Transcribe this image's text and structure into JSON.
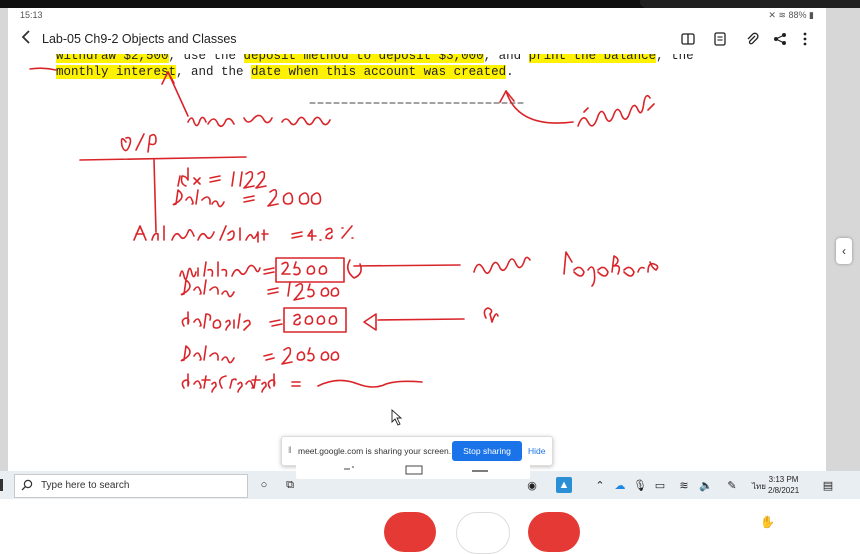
{
  "status_bar": {
    "time": "15:13",
    "battery": "88%"
  },
  "header": {
    "back_icon": "chevron-left-icon",
    "title": "Lab-05 Ch9-2 Objects and Classes",
    "actions": [
      "book-icon",
      "note-icon",
      "paperclip-icon",
      "share-icon",
      "more-vertical-icon"
    ]
  },
  "document": {
    "line1": {
      "p1": "withdraw $2,500",
      "p2": ", use the ",
      "p3": "deposit method to ",
      "p4": "deposit $3,000",
      "p5": ", and ",
      "p6": "print the balance",
      "p7": ", the"
    },
    "line2": {
      "p1": "monthly interest",
      "p2": ", and the ",
      "p3": "date when this account was created",
      "p4": "."
    }
  },
  "share_bar": {
    "message": "meet.google.com is sharing your screen.",
    "stop_label": "Stop sharing",
    "hide_label": "Hide"
  },
  "taskbar": {
    "search_placeholder": "Type here to search",
    "lang": "ไทย",
    "time": "3:13 PM",
    "date": "2/8/2021"
  },
  "colors": {
    "ink": "#d9252a",
    "highlight": "#fff200",
    "stop_button": "#1a73e8",
    "call_red": "#e53935"
  }
}
